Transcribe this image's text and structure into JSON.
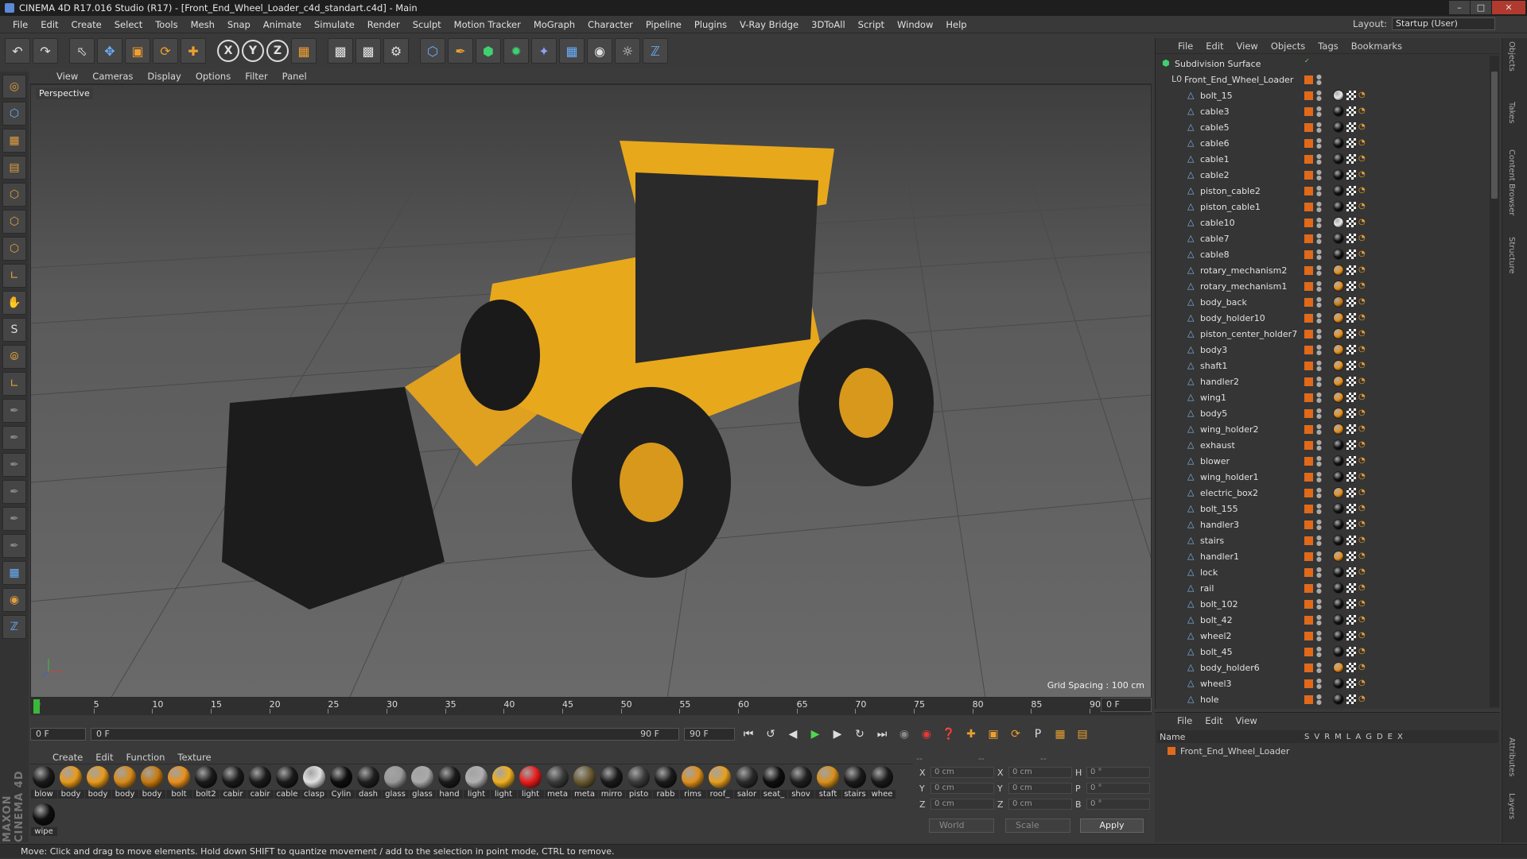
{
  "window": {
    "title": "CINEMA 4D R17.016 Studio (R17) - [Front_End_Wheel_Loader_c4d_standart.c4d] - Main"
  },
  "menubar": [
    "File",
    "Edit",
    "Create",
    "Select",
    "Tools",
    "Mesh",
    "Snap",
    "Animate",
    "Simulate",
    "Render",
    "Sculpt",
    "Motion Tracker",
    "MoGraph",
    "Character",
    "Pipeline",
    "Plugins",
    "V-Ray Bridge",
    "3DToAll",
    "Script",
    "Window",
    "Help"
  ],
  "layout": {
    "label": "Layout:",
    "value": "Startup (User)"
  },
  "viewport": {
    "menu": [
      "View",
      "Cameras",
      "Display",
      "Options",
      "Filter",
      "Panel"
    ],
    "camera_label": "Perspective",
    "grid_spacing": "Grid Spacing : 100 cm"
  },
  "timeline": {
    "ticks": [
      "0",
      "5",
      "10",
      "15",
      "20",
      "25",
      "30",
      "35",
      "40",
      "45",
      "50",
      "55",
      "60",
      "65",
      "70",
      "75",
      "80",
      "85",
      "90"
    ],
    "end_frame": "0 F",
    "current": "0 F",
    "range_start": "0 F",
    "range_end": "90 F",
    "max": "90 F"
  },
  "material_menu": [
    "Create",
    "Edit",
    "Function",
    "Texture"
  ],
  "materials": [
    {
      "name": "blow",
      "color": "#1a1a1a"
    },
    {
      "name": "body",
      "color": "#e89a1c"
    },
    {
      "name": "body",
      "color": "#e89a1c"
    },
    {
      "name": "body",
      "color": "#d88a18"
    },
    {
      "name": "body",
      "color": "#c87a10"
    },
    {
      "name": "bolt",
      "color": "#e8901c"
    },
    {
      "name": "bolt2",
      "color": "#1a1a1a"
    },
    {
      "name": "cabir",
      "color": "#1a1a1a"
    },
    {
      "name": "cabir",
      "color": "#1a1a1a"
    },
    {
      "name": "cable",
      "color": "#1a1a1a"
    },
    {
      "name": "clasp",
      "color": "#e0e0e0"
    },
    {
      "name": "Cylin",
      "color": "#0e0e0e"
    },
    {
      "name": "dash",
      "color": "#1f1f1f"
    },
    {
      "name": "glass",
      "color": "#9a9a9a"
    },
    {
      "name": "glass",
      "color": "#aaaaaa"
    },
    {
      "name": "hand",
      "color": "#1a1a1a"
    },
    {
      "name": "light",
      "color": "#b0b0b0"
    },
    {
      "name": "light",
      "color": "#f0b020"
    },
    {
      "name": "light",
      "color": "#e81c1c"
    },
    {
      "name": "meta",
      "color": "#3a3a3a"
    },
    {
      "name": "meta",
      "color": "#6a5a30"
    },
    {
      "name": "mirro",
      "color": "#1a1a1a"
    },
    {
      "name": "pisto",
      "color": "#3a3a3a"
    },
    {
      "name": "rabb",
      "color": "#1a1a1a"
    },
    {
      "name": "rims",
      "color": "#e0901c"
    },
    {
      "name": "roof_",
      "color": "#e8a020"
    },
    {
      "name": "salor",
      "color": "#2a2a2a"
    },
    {
      "name": "seat_",
      "color": "#0e0e0e"
    },
    {
      "name": "shov",
      "color": "#1f1f1f"
    },
    {
      "name": "staft",
      "color": "#d8901c"
    },
    {
      "name": "stairs",
      "color": "#1a1a1a"
    },
    {
      "name": "whee",
      "color": "#1a1a1a"
    },
    {
      "name": "wipe",
      "color": "#0e0e0e"
    }
  ],
  "coords": {
    "rows": [
      {
        "a": "X",
        "av": "0 cm",
        "b": "X",
        "bv": "0 cm",
        "c": "H",
        "cv": "0 °"
      },
      {
        "a": "Y",
        "av": "0 cm",
        "b": "Y",
        "bv": "0 cm",
        "c": "P",
        "cv": "0 °"
      },
      {
        "a": "Z",
        "av": "0 cm",
        "b": "Z",
        "bv": "0 cm",
        "c": "B",
        "cv": "0 °"
      }
    ],
    "world": "World",
    "scale": "Scale",
    "apply": "Apply",
    "top_a": "--",
    "top_b": "--",
    "top_c": "--"
  },
  "object_manager": {
    "menu": [
      "File",
      "Edit",
      "View",
      "Objects",
      "Tags",
      "Bookmarks"
    ],
    "root": "Subdivision Surface",
    "group": "Front_End_Wheel_Loader",
    "items": [
      {
        "name": "bolt_15",
        "tag": "#e8e8e8"
      },
      {
        "name": "cable3",
        "tag": "#111"
      },
      {
        "name": "cable5",
        "tag": "#111"
      },
      {
        "name": "cable6",
        "tag": "#111"
      },
      {
        "name": "cable1",
        "tag": "#111"
      },
      {
        "name": "cable2",
        "tag": "#111"
      },
      {
        "name": "piston_cable2",
        "tag": "#111"
      },
      {
        "name": "piston_cable1",
        "tag": "#111"
      },
      {
        "name": "cable10",
        "tag": "#e8e8e8"
      },
      {
        "name": "cable7",
        "tag": "#111"
      },
      {
        "name": "cable8",
        "tag": "#111"
      },
      {
        "name": "rotary_mechanism2",
        "tag": "#e8901c"
      },
      {
        "name": "rotary_mechanism1",
        "tag": "#e8901c"
      },
      {
        "name": "body_back",
        "tag": "#c87a10"
      },
      {
        "name": "body_holder10",
        "tag": "#e8901c"
      },
      {
        "name": "piston_center_holder7",
        "tag": "#e8901c"
      },
      {
        "name": "body3",
        "tag": "#e8901c"
      },
      {
        "name": "shaft1",
        "tag": "#e8901c"
      },
      {
        "name": "handler2",
        "tag": "#e8901c"
      },
      {
        "name": "wing1",
        "tag": "#e8901c"
      },
      {
        "name": "body5",
        "tag": "#e8901c"
      },
      {
        "name": "wing_holder2",
        "tag": "#e8901c"
      },
      {
        "name": "exhaust",
        "tag": "#111"
      },
      {
        "name": "blower",
        "tag": "#111"
      },
      {
        "name": "wing_holder1",
        "tag": "#111"
      },
      {
        "name": "electric_box2",
        "tag": "#e8901c"
      },
      {
        "name": "bolt_155",
        "tag": "#111"
      },
      {
        "name": "handler3",
        "tag": "#111"
      },
      {
        "name": "stairs",
        "tag": "#111"
      },
      {
        "name": "handler1",
        "tag": "#e8901c"
      },
      {
        "name": "lock",
        "tag": "#111"
      },
      {
        "name": "rail",
        "tag": "#111"
      },
      {
        "name": "bolt_102",
        "tag": "#111"
      },
      {
        "name": "bolt_42",
        "tag": "#111"
      },
      {
        "name": "wheel2",
        "tag": "#111"
      },
      {
        "name": "bolt_45",
        "tag": "#111"
      },
      {
        "name": "body_holder6",
        "tag": "#e8901c"
      },
      {
        "name": "wheel3",
        "tag": "#111"
      },
      {
        "name": "hole",
        "tag": "#111"
      }
    ]
  },
  "attribute_manager": {
    "menu": [
      "File",
      "Edit",
      "View"
    ],
    "name_header": "Name",
    "columns": [
      "S",
      "V",
      "R",
      "M",
      "L",
      "A",
      "G",
      "D",
      "E",
      "X"
    ],
    "row": "Front_End_Wheel_Loader"
  },
  "right_tabs": [
    "Objects",
    "Takes",
    "Content Browser",
    "Structure",
    "Attributes",
    "Layers"
  ],
  "status": "Move: Click and drag to move elements. Hold down SHIFT to quantize movement / add to the selection in point mode, CTRL to remove."
}
